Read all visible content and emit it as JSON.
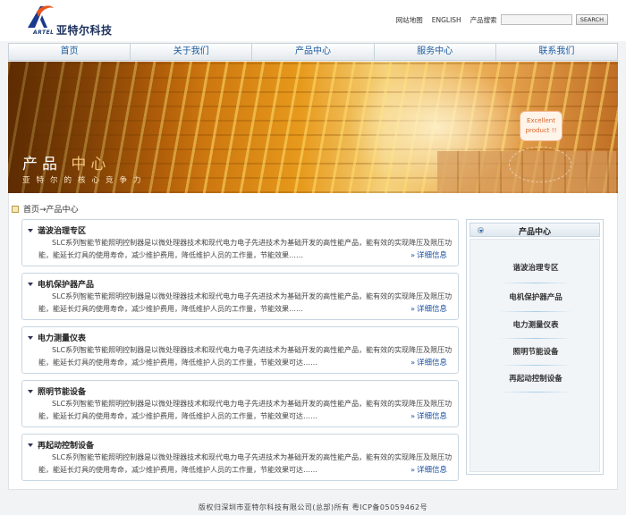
{
  "header": {
    "logo_mark": "A",
    "logo_sub": "ARTEL",
    "logo_text": "亚特尔科技",
    "sitemap_label": "网站地图",
    "english_label": "ENGLISH",
    "search_label": "产品搜索",
    "search_placeholder": "",
    "search_button": "SEARCH"
  },
  "nav": {
    "tabs": [
      {
        "label": "首页"
      },
      {
        "label": "关于我们"
      },
      {
        "label": "产品中心"
      },
      {
        "label": "服务中心"
      },
      {
        "label": "联系我们"
      }
    ]
  },
  "banner": {
    "title_main": "产品",
    "title_highlight": "中心",
    "subtitle": "亚特尔的核心竞争力",
    "bubble_line1": "Excellent",
    "bubble_line2": "product !!"
  },
  "breadcrumb": {
    "text": "首页→产品中心"
  },
  "products": [
    {
      "title": "谐波治理专区",
      "desc": "SLC系列智能节能照明控制器是以微处理器技术和现代电力电子先进技术为基础开发的高性能产品，能有效的实现降压及限压功能，能延长灯具的使用寿命，减少维护费用，降低维护人员的工作量，节能效果……",
      "more": "详细信息"
    },
    {
      "title": "电机保护器产品",
      "desc": "SLC系列智能节能照明控制器是以微处理器技术和现代电力电子先进技术为基础开发的高性能产品，能有效的实现降压及限压功能，能延长灯具的使用寿命，减少维护费用，降低维护人员的工作量，节能效果……",
      "more": "详细信息"
    },
    {
      "title": "电力测量仪表",
      "desc": "SLC系列智能节能照明控制器是以微处理器技术和现代电力电子先进技术为基础开发的高性能产品，能有效的实现降压及限压功能，能延长灯具的使用寿命，减少维护费用，降低维护人员的工作量，节能效果可达……",
      "more": "详细信息"
    },
    {
      "title": "照明节能设备",
      "desc": "SLC系列智能节能照明控制器是以微处理器技术和现代电力电子先进技术为基础开发的高性能产品，能有效的实现降压及限压功能，能延长灯具的使用寿命，减少维护费用，降低维护人员的工作量，节能效果可达……",
      "more": "详细信息"
    },
    {
      "title": "再起动控制设备",
      "desc": "SLC系列智能节能照明控制器是以微处理器技术和现代电力电子先进技术为基础开发的高性能产品，能有效的实现降压及限压功能，能延长灯具的使用寿命，减少维护费用，降低维护人员的工作量，节能效果可达……",
      "more": "详细信息"
    }
  ],
  "sidebar": {
    "title": "产品中心",
    "items": [
      {
        "label": "谐波治理专区"
      },
      {
        "label": "电机保护器产品"
      },
      {
        "label": "电力测量仪表"
      },
      {
        "label": "照明节能设备"
      },
      {
        "label": "再起动控制设备"
      }
    ]
  },
  "footer": {
    "text": "版权归深圳市亚特尔科技有限公司(总部)所有  粤ICP备05059462号"
  },
  "colors": {
    "nav_text": "#1a5a9e",
    "link": "#1a4f9e",
    "banner_orange": "#e79a1c"
  }
}
